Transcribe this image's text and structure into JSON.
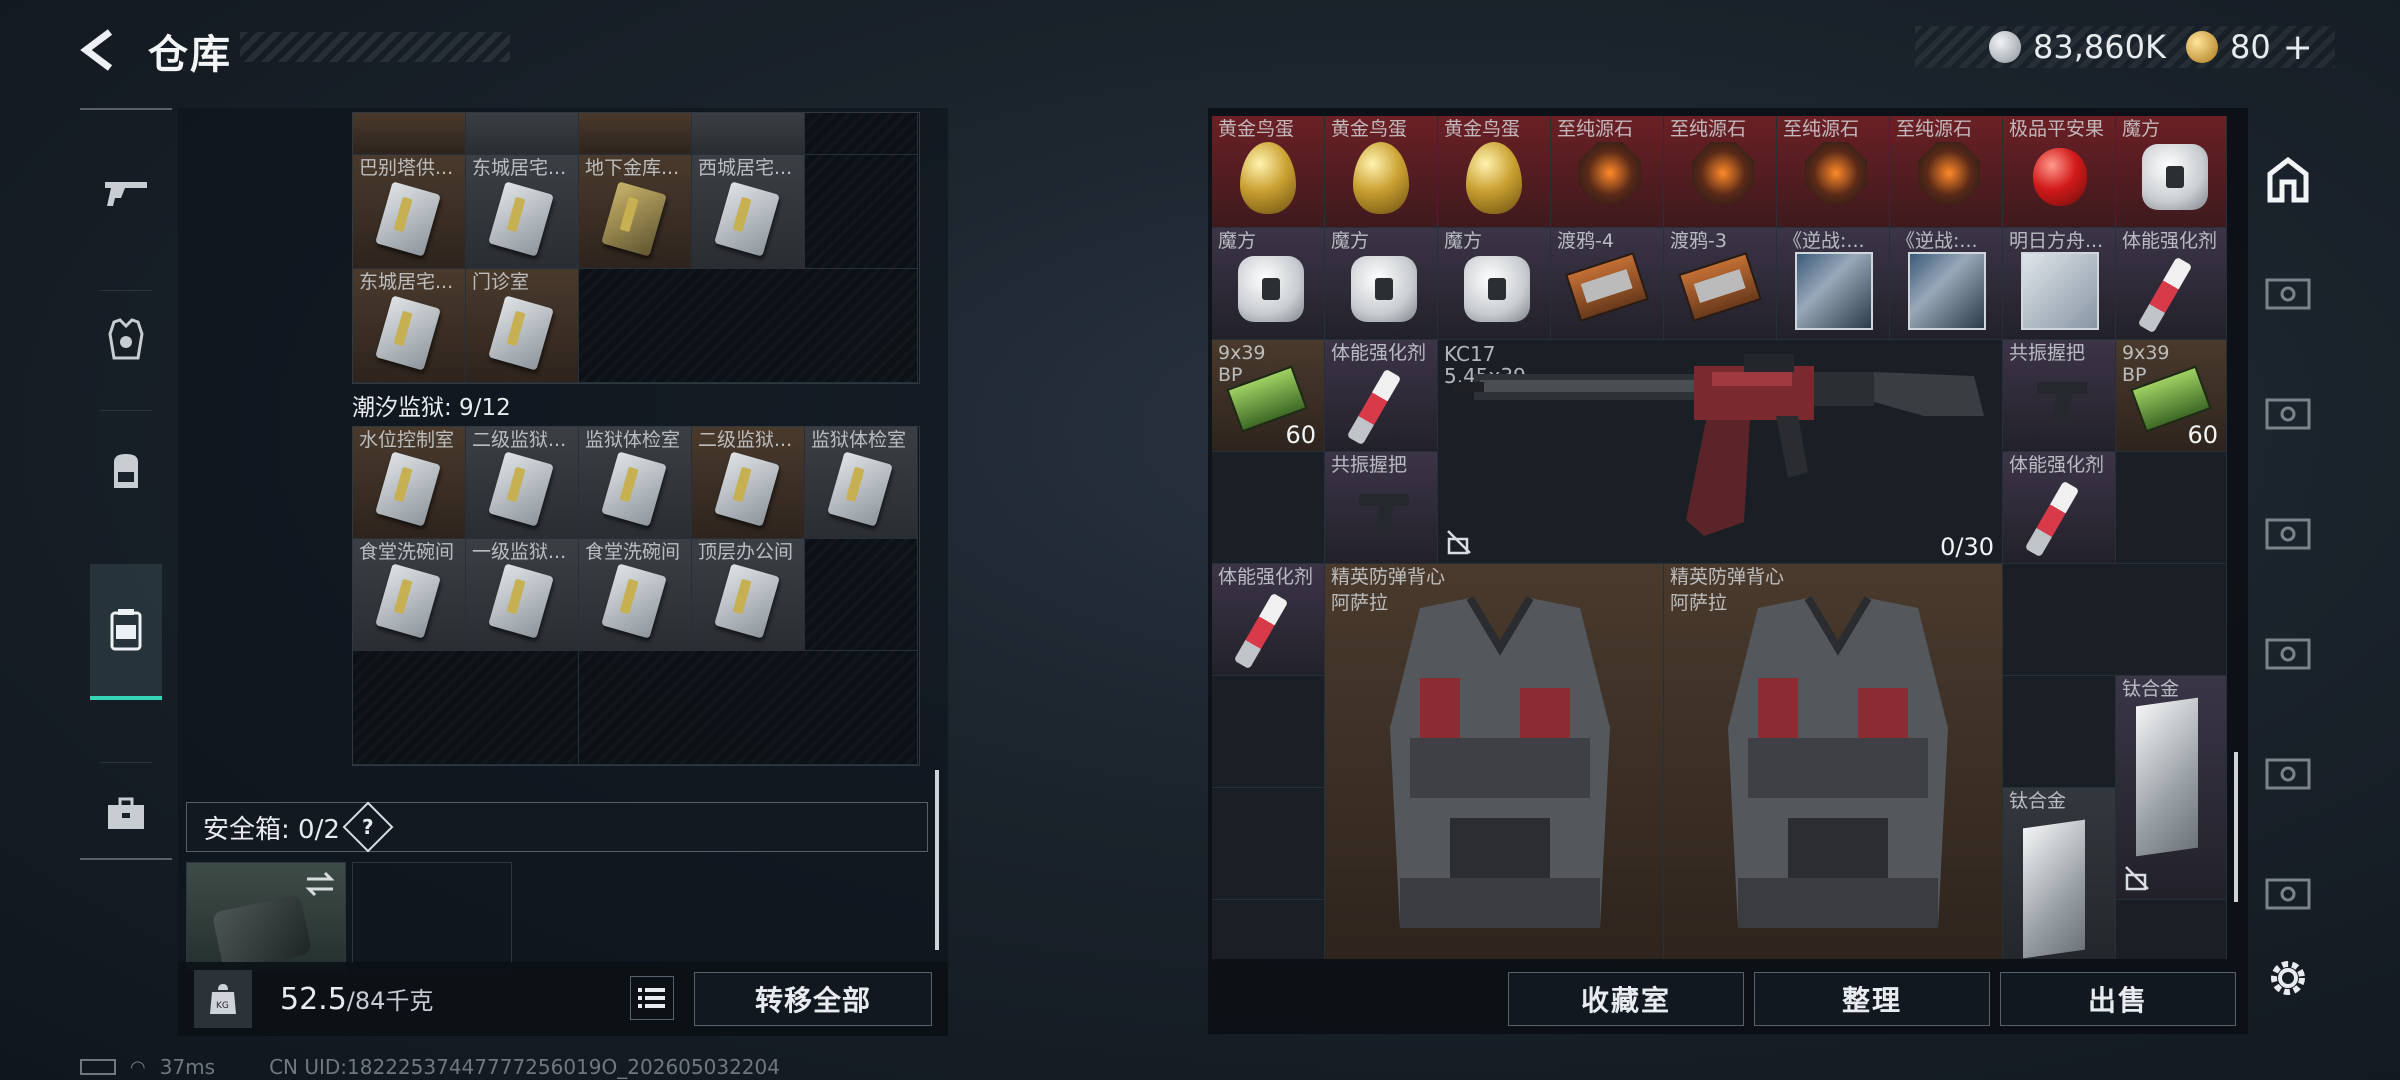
{
  "header": {
    "title": "仓库",
    "currency1": "83,860K",
    "currency2": "80",
    "add_symbol": "+"
  },
  "left": {
    "grid1": {
      "items": [
        {
          "label": "巴别塔供..."
        },
        {
          "label": "东城居宅..."
        },
        {
          "label": "地下金库..."
        },
        {
          "label": "西城居宅..."
        },
        {
          "label": "东城居宅..."
        },
        {
          "label": "门诊室"
        }
      ]
    },
    "section2_title": "潮汐监狱: 9/12",
    "grid2": {
      "items": [
        {
          "label": "水位控制室"
        },
        {
          "label": "二级监狱..."
        },
        {
          "label": "监狱体检室"
        },
        {
          "label": "二级监狱..."
        },
        {
          "label": "监狱体检室"
        },
        {
          "label": "食堂洗碗间"
        },
        {
          "label": "一级监狱..."
        },
        {
          "label": "食堂洗碗间"
        },
        {
          "label": "顶层办公间"
        }
      ]
    },
    "safe_box_label": "安全箱: 0/2",
    "help_symbol": "?",
    "weight_current": "52.5",
    "weight_max": "/84千克",
    "transfer_all_label": "转移全部"
  },
  "status": {
    "ping": "37ms",
    "uid": "CN UID:18222537447777256019O_202605032204"
  },
  "right": {
    "row1": [
      {
        "label": "黄金鸟蛋"
      },
      {
        "label": "黄金鸟蛋"
      },
      {
        "label": "黄金鸟蛋"
      },
      {
        "label": "至纯源石"
      },
      {
        "label": "至纯源石"
      },
      {
        "label": "至纯源石"
      },
      {
        "label": "至纯源石"
      },
      {
        "label": "极品平安果"
      },
      {
        "label": "魔方"
      }
    ],
    "row2": [
      {
        "label": "魔方"
      },
      {
        "label": "魔方"
      },
      {
        "label": "魔方"
      },
      {
        "label": "渡鸦-4"
      },
      {
        "label": "渡鸦-3"
      },
      {
        "label": "《逆战:..."
      },
      {
        "label": "《逆战:..."
      },
      {
        "label": "明日方舟..."
      },
      {
        "label": "体能强化剂"
      }
    ],
    "ammo1": {
      "label": "9x39",
      "label2": "BP",
      "count": "60"
    },
    "stim1": {
      "label": "体能强化剂"
    },
    "gun": {
      "name": "KC17",
      "caliber": "5.45x39",
      "ammo": "0/30"
    },
    "grip1": {
      "label": "共振握把"
    },
    "ammo2": {
      "label": "9x39",
      "label2": "BP",
      "count": "60"
    },
    "grip2": {
      "label": "共振握把"
    },
    "stim2": {
      "label": "体能强化剂"
    },
    "stim3": {
      "label": "体能强化剂"
    },
    "vest1": {
      "label": "精英防弹背心",
      "label2": "阿萨拉"
    },
    "vest2": {
      "label": "精英防弹背心",
      "label2": "阿萨拉"
    },
    "ingot1": {
      "label": "钛合金"
    },
    "ingot2": {
      "label": "钛合金"
    },
    "buttons": {
      "collection": "收藏室",
      "organize": "整理",
      "sell": "出售"
    }
  }
}
